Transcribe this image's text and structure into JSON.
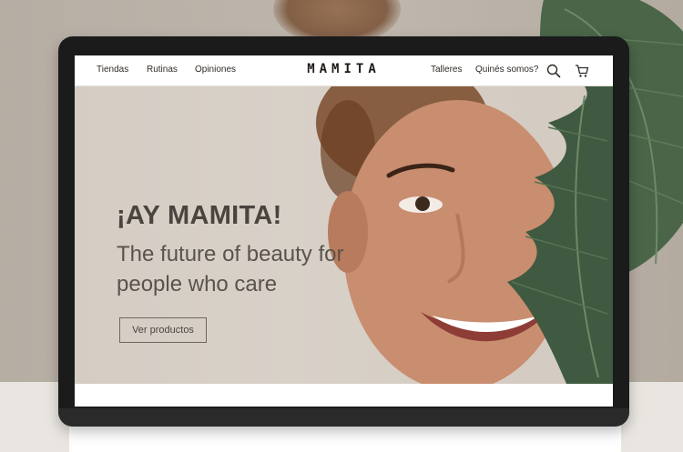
{
  "nav": {
    "left_links": [
      "Tiendas",
      "Rutinas",
      "Opiniones"
    ],
    "brand": "MAMITA",
    "right_links": [
      "Talleres",
      "Quinés somos?"
    ],
    "icons": [
      "search-icon",
      "cart-icon"
    ]
  },
  "hero": {
    "title": "¡AY MAMITA!",
    "subtitle": "The future of beauty for people who care",
    "cta_label": "Ver productos"
  },
  "colors": {
    "hero_background": "#d6cec5",
    "heading_text": "#4a443f",
    "device_frame": "#1b1b1b",
    "leaf_green": "#3f5a40"
  }
}
